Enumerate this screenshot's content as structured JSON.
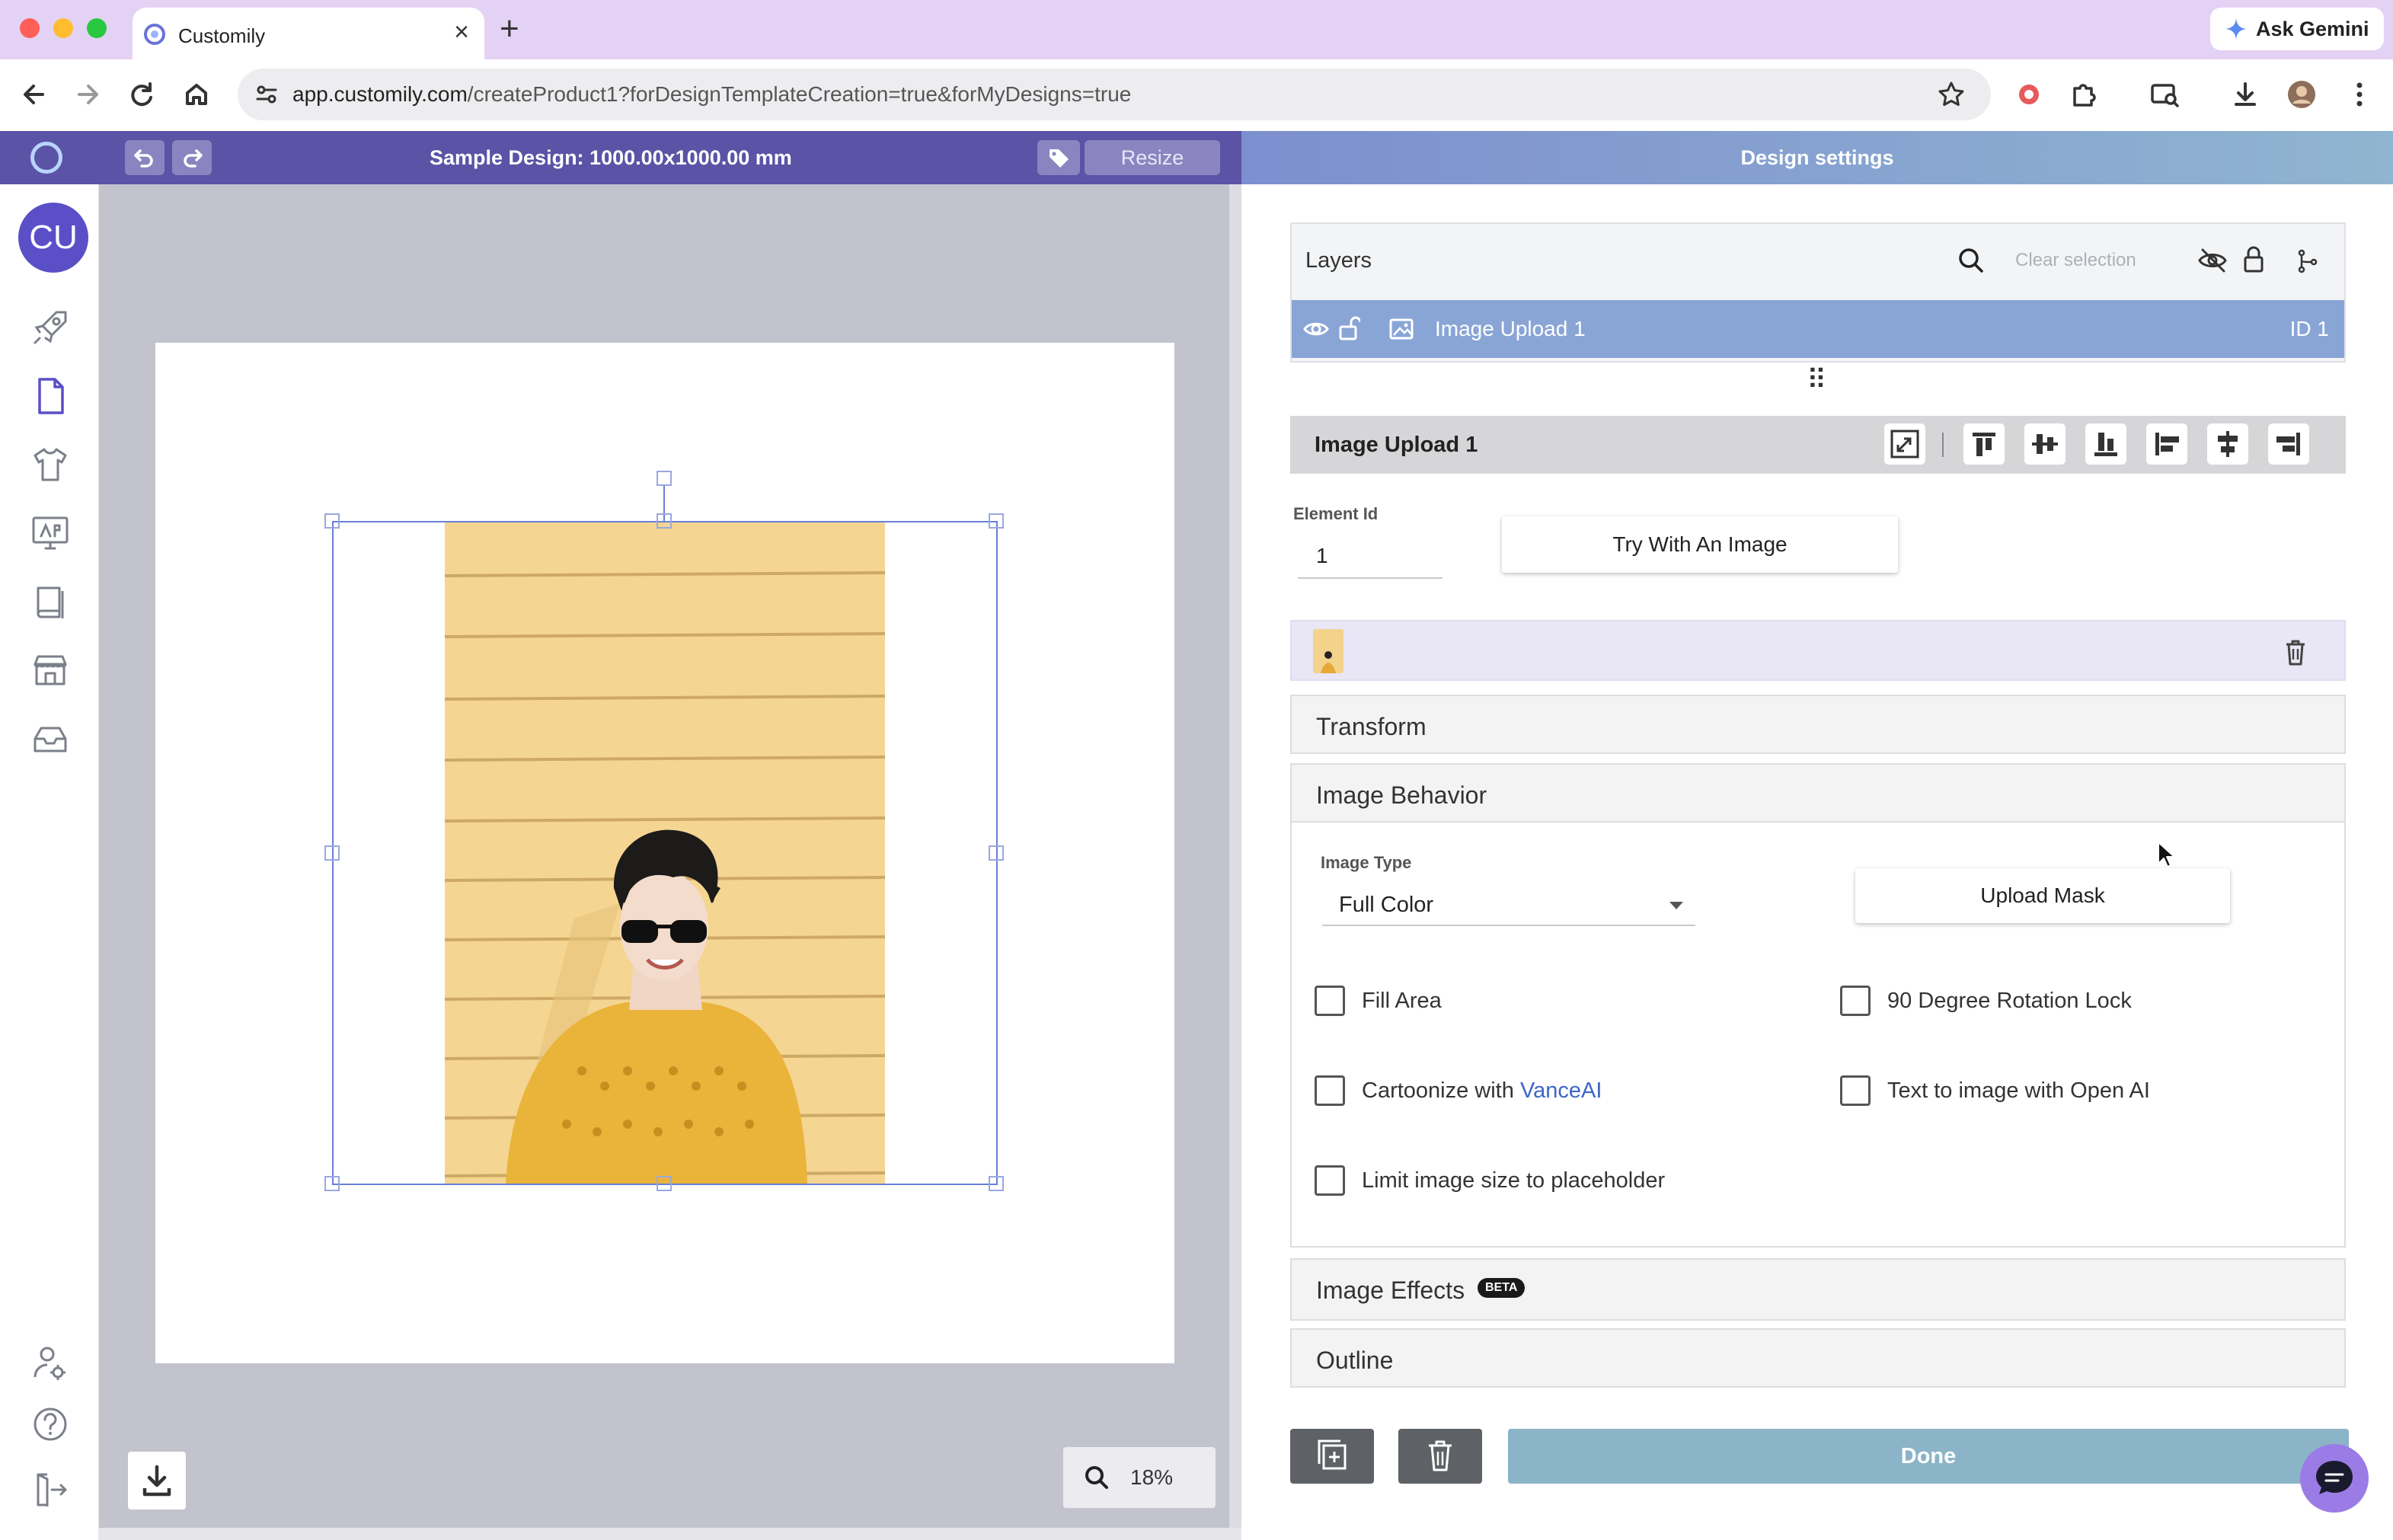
{
  "browser": {
    "tab_title": "Customily",
    "url_host": "app.customily.com",
    "url_path": "/createProduct1?forDesignTemplateCreation=true&forMyDesigns=true",
    "ask_gemini": "Ask Gemini"
  },
  "app": {
    "design_title": "Sample Design: 1000.00x1000.00 mm",
    "resize_label": "Resize",
    "settings_title": "Design settings",
    "avatar_initials": "CU"
  },
  "canvas": {
    "zoom": "18%"
  },
  "layers": {
    "title": "Layers",
    "clear_selection": "Clear selection",
    "items": [
      {
        "name": "Image Upload 1",
        "id": "ID 1"
      }
    ]
  },
  "element": {
    "title": "Image Upload 1",
    "id_label": "Element Id",
    "id_value": "1",
    "try_image": "Try With An Image"
  },
  "sections": {
    "transform": "Transform",
    "image_behavior": "Image Behavior",
    "image_effects": "Image Effects",
    "beta": "BETA",
    "outline": "Outline"
  },
  "behavior": {
    "image_type_label": "Image Type",
    "image_type_value": "Full Color",
    "upload_mask": "Upload Mask",
    "checkboxes": {
      "fill_area": "Fill Area",
      "rotation_lock": "90 Degree Rotation Lock",
      "cartoonize_prefix": "Cartoonize with ",
      "cartoonize_link": "VanceAI",
      "text_to_image": "Text to image with Open AI",
      "limit_size": "Limit image size to placeholder"
    }
  },
  "actions": {
    "done": "Done"
  },
  "colors": {
    "app_header": "#5b53a6",
    "selected_layer": "#89a5d6",
    "done_button": "#8cb4c8",
    "link": "#3d66c9"
  }
}
